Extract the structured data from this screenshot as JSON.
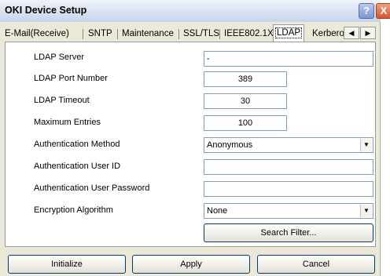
{
  "window": {
    "title": "OKI Device Setup",
    "help_label": "?",
    "close_label": "X"
  },
  "tabs": [
    {
      "label": "E-Mail(Receive)"
    },
    {
      "label": "SNTP"
    },
    {
      "label": "Maintenance"
    },
    {
      "label": "SSL/TLS"
    },
    {
      "label": "IEEE802.1X"
    },
    {
      "label": "LDAP",
      "active": true
    },
    {
      "label": "Kerberos"
    }
  ],
  "tab_scroll": {
    "left": "◀",
    "right": "▶"
  },
  "fields": {
    "ldap_server": {
      "label": "LDAP Server",
      "value": "-"
    },
    "ldap_port": {
      "label": "LDAP Port Number",
      "value": "389"
    },
    "ldap_timeout": {
      "label": "LDAP Timeout",
      "value": "30"
    },
    "max_entries": {
      "label": "Maximum Entries",
      "value": "100"
    },
    "auth_method": {
      "label": "Authentication Method",
      "value": "Anonymous"
    },
    "auth_user_id": {
      "label": "Authentication User ID",
      "value": ""
    },
    "auth_user_password": {
      "label": "Authentication User Password",
      "value": ""
    },
    "encryption": {
      "label": "Encryption Algorithm",
      "value": "None"
    }
  },
  "dropdown_glyph": "▼",
  "buttons": {
    "search_filter": "Search Filter...",
    "initialize": "Initialize",
    "apply": "Apply",
    "cancel": "Cancel"
  }
}
